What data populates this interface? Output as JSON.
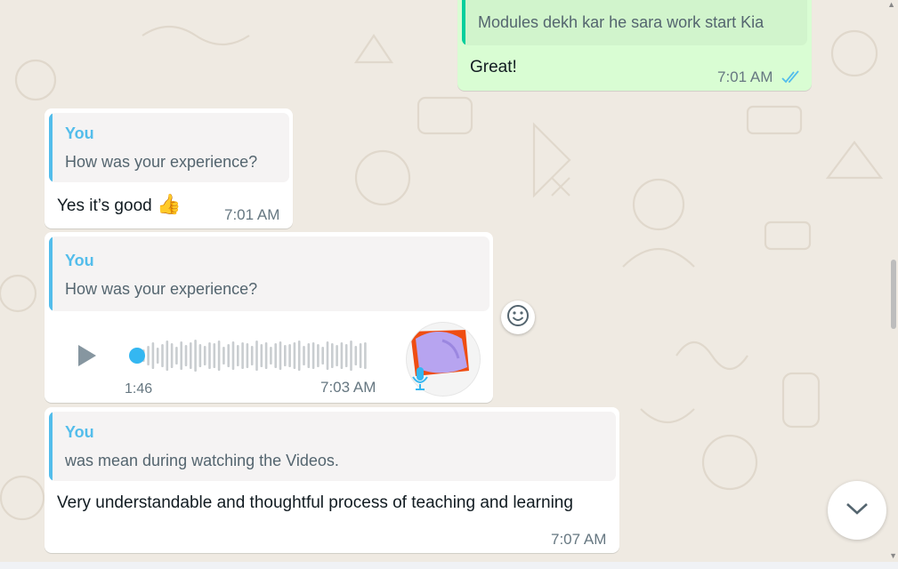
{
  "messages": [
    {
      "direction": "outgoing",
      "quote_text": "Modules dekh kar he sara work start Kia",
      "text": "Great!",
      "time": "7:01 AM",
      "status": "read-double-tick"
    },
    {
      "direction": "incoming",
      "quote_author": "You",
      "quote_text": "How was your experience?",
      "text": "Yes it’s good",
      "emoji": "👍",
      "time": "7:01 AM"
    },
    {
      "direction": "incoming",
      "type": "voice",
      "quote_author": "You",
      "quote_text": "How was your experience?",
      "duration": "1:46",
      "time": "7:03 AM",
      "playback_progress": 0.0
    },
    {
      "direction": "incoming",
      "quote_author": "You",
      "quote_text": "was mean during watching the Videos.",
      "text": "Very understandable and thoughtful process of teaching and learning",
      "time": "7:07 AM"
    }
  ],
  "icons": {
    "play": "play-icon",
    "mic": "mic-icon",
    "react": "smiley-icon",
    "scroll_down": "chevron-down-icon",
    "read": "double-check-icon"
  },
  "colors": {
    "outgoing_bubble": "#d9fdd3",
    "incoming_bubble": "#ffffff",
    "quote_author": "#53bdeb",
    "read_tick": "#53bdeb",
    "background": "#efeae2"
  }
}
